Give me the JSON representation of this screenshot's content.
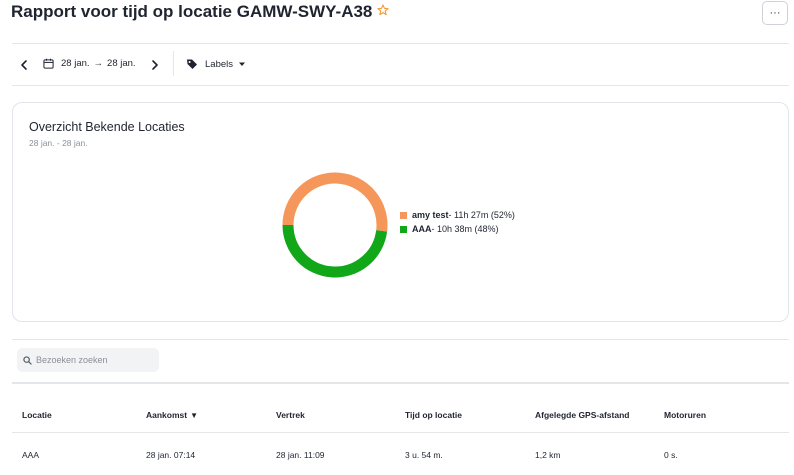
{
  "header": {
    "title": "Rapport voor tijd op locatie GAMW-SWY-A38",
    "more_label": "···"
  },
  "toolbar": {
    "date_from": "28 jan.",
    "arrow": "→",
    "date_to": "28 jan.",
    "labels_label": "Labels"
  },
  "card": {
    "title": "Overzicht Bekende Locaties",
    "subtitle": "28 jan. - 28 jan."
  },
  "chart_data": {
    "type": "pie",
    "donut": true,
    "categories": [
      "amy test",
      "AAA"
    ],
    "values": [
      52,
      48
    ],
    "durations": [
      "11h 27m",
      "10h 38m"
    ],
    "percent_labels": [
      "(52%)",
      "(48%)"
    ],
    "colors": [
      "#f5975a",
      "#12a619"
    ],
    "legend_position": "right"
  },
  "legend": [
    {
      "name": "amy test",
      "detail": " - 11h 27m (52%)"
    },
    {
      "name": "AAA",
      "detail": " - 10h 38m (48%)"
    }
  ],
  "search": {
    "placeholder": "Bezoeken zoeken"
  },
  "table": {
    "columns": [
      "Locatie",
      "Aankomst",
      "Vertrek",
      "Tijd op locatie",
      "Afgelegde GPS-afstand",
      "Motoruren"
    ],
    "sort_indicator": "▼",
    "rows": [
      [
        "AAA",
        "28 jan. 07:14",
        "28 jan. 11:09",
        "3 u. 54 m.",
        "1,2 km",
        "0 s."
      ]
    ]
  },
  "colors": {
    "accent_star": "#f29a38",
    "text": "#1f2430",
    "muted": "#8a8f98",
    "border": "#e4e6ea"
  }
}
